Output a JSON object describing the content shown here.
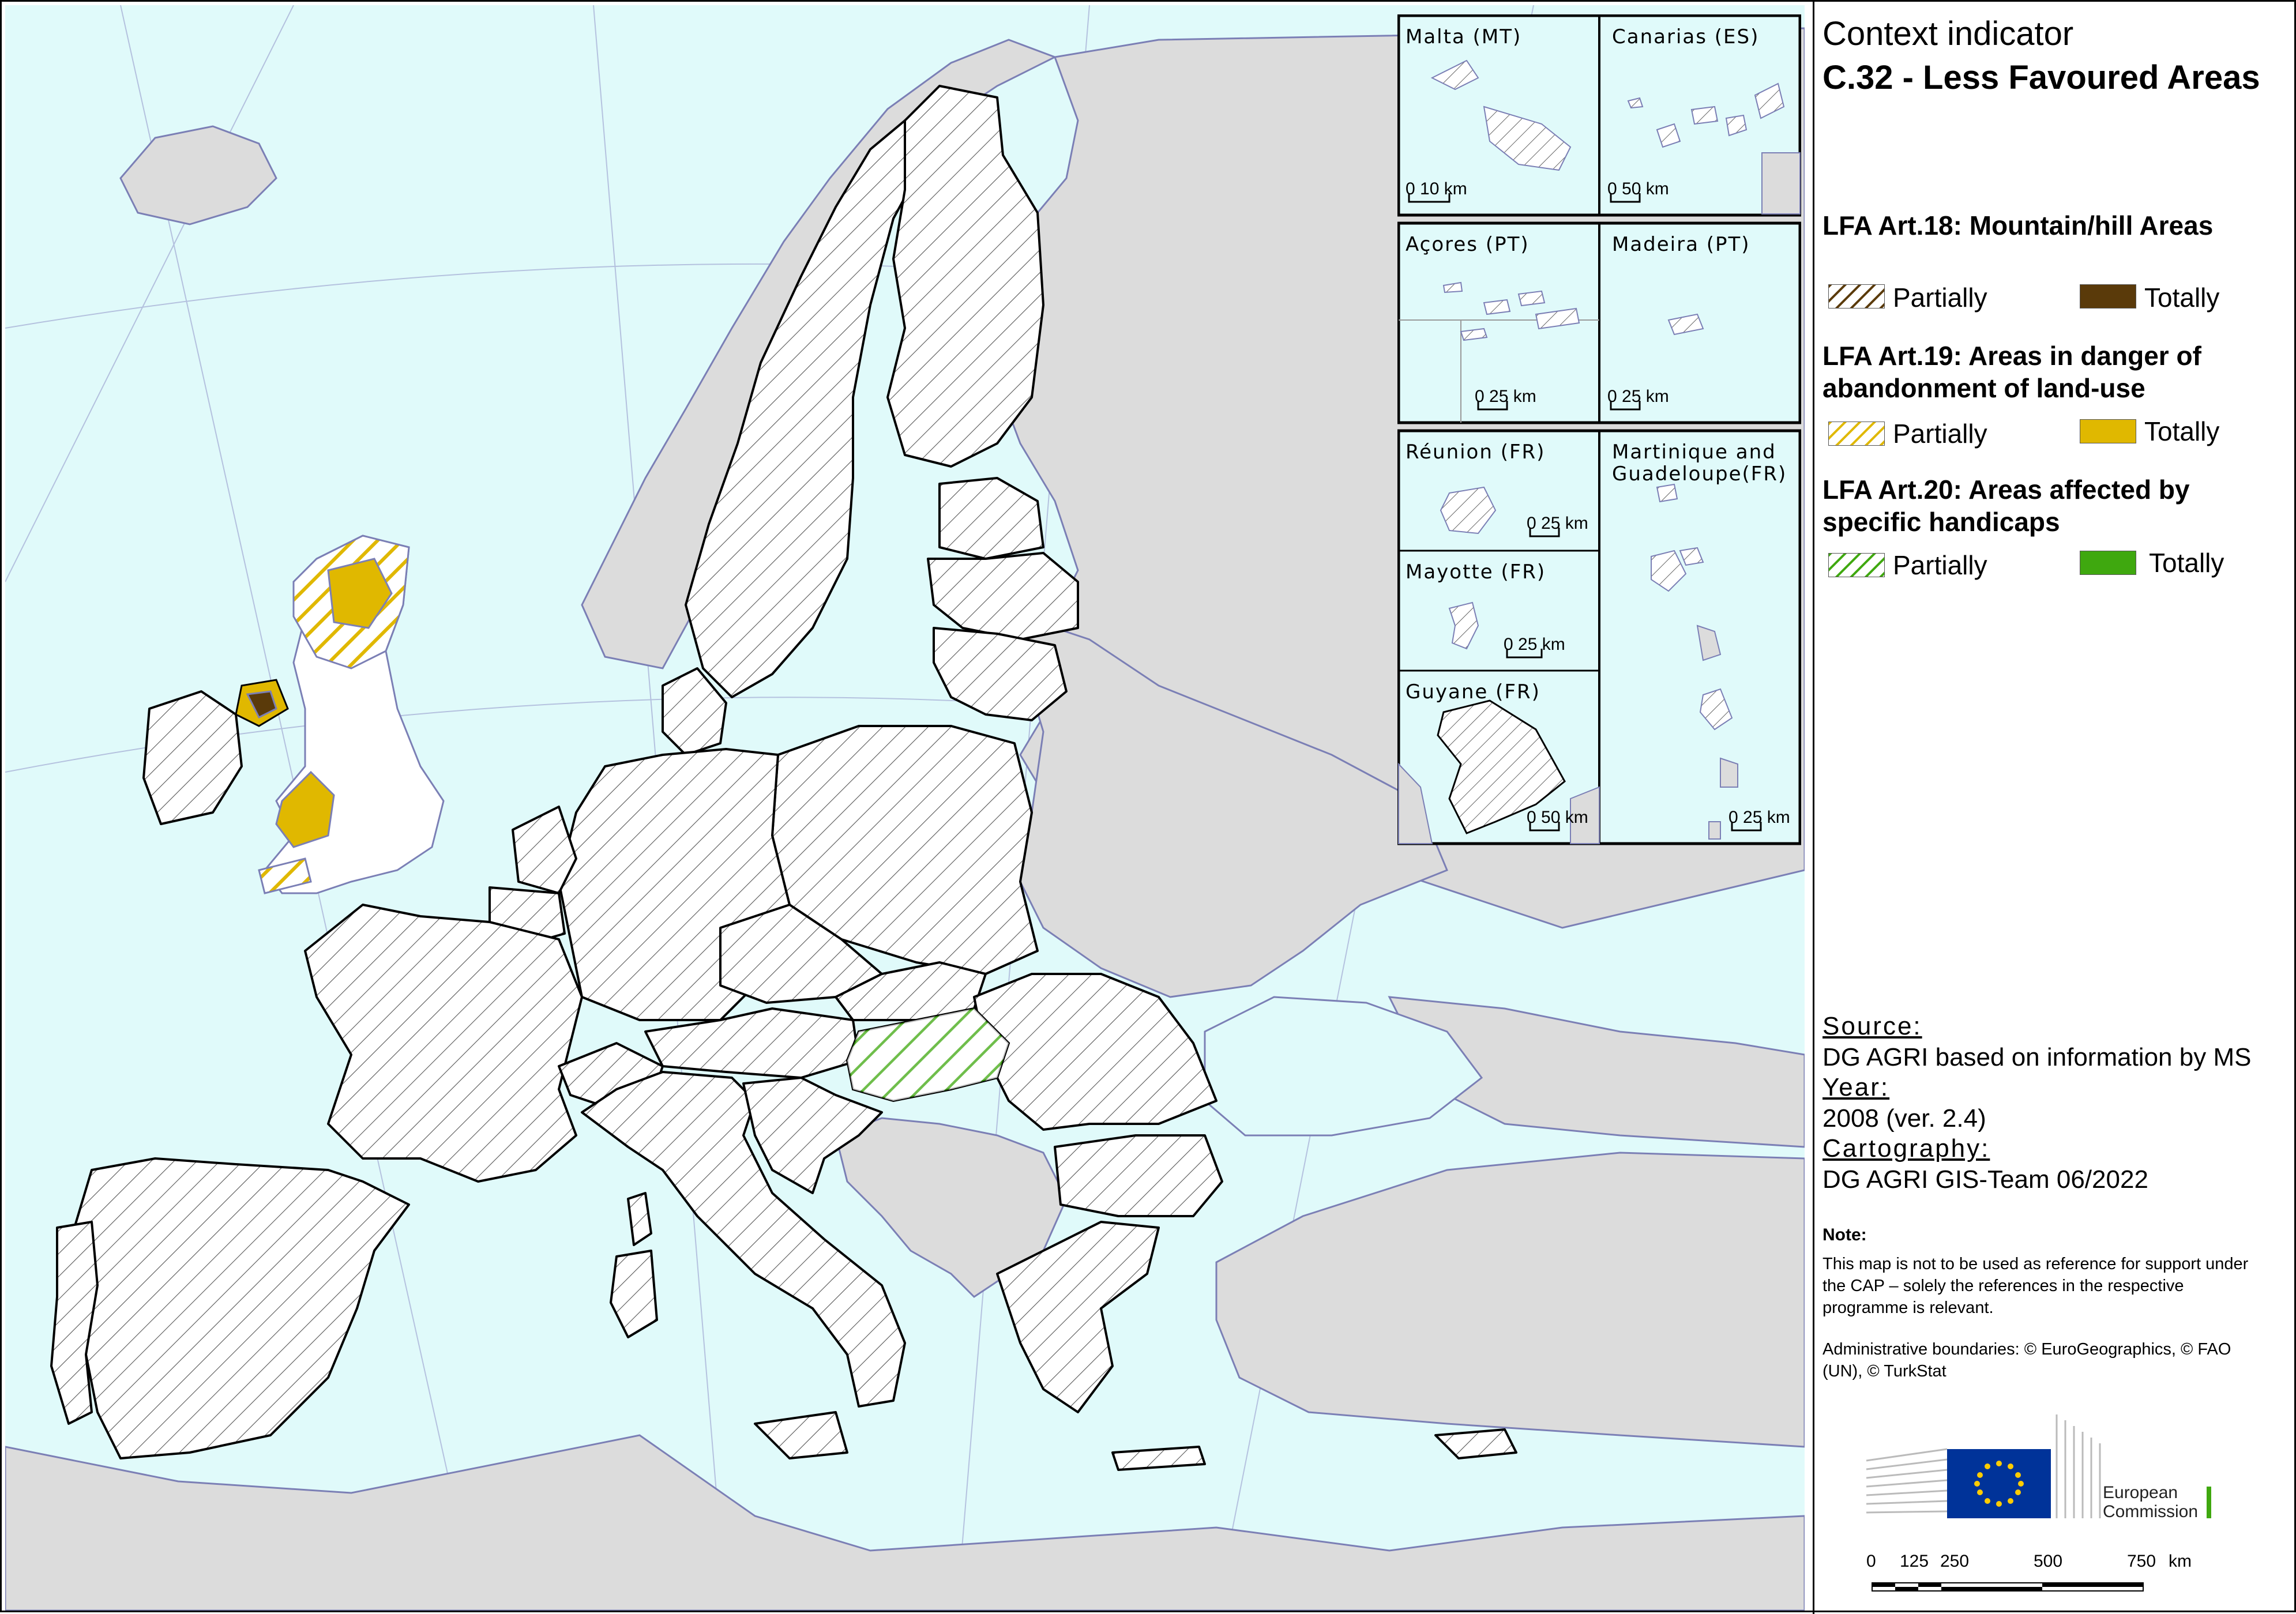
{
  "title": {
    "line1": "Context indicator",
    "line2": "C.32 - Less Favoured Areas"
  },
  "legend": {
    "art18": {
      "heading": "LFA Art.18: Mountain/hill Areas",
      "partially": "Partially",
      "totally": "Totally",
      "color": "#5a3a0a"
    },
    "art19": {
      "heading": "LFA Art.19: Areas in danger of abandonment of land-use",
      "partially": "Partially",
      "totally": "Totally",
      "color": "#e0b800"
    },
    "art20": {
      "heading": "LFA Art.20: Areas affected by specific handicaps",
      "partially": "Partially",
      "totally": "Totally",
      "color": "#3fa80f"
    }
  },
  "source": {
    "source_label": "Source:",
    "source_text": "DG AGRI based on information by MS",
    "year_label": "Year:",
    "year_text": "2008 (ver. 2.4)",
    "carto_label": "Cartography:",
    "carto_text": "DG AGRI GIS-Team 06/2022"
  },
  "note": {
    "label": "Note:",
    "text": "This map is not to be used as reference for support under the CAP – solely the references in the respective programme is relevant.",
    "admin": "Administrative boundaries: © EuroGeographics, © FAO (UN), © TurkStat"
  },
  "logo": {
    "line1": "European",
    "line2": "Commission"
  },
  "scalebar": {
    "labels": [
      "0",
      "125",
      "250",
      "500",
      "750"
    ],
    "unit": "km"
  },
  "insets": {
    "malta": {
      "name": "Malta (MT)",
      "scale": "0    10 km"
    },
    "canarias": {
      "name": "Canarias (ES)",
      "scale": "0 50 km"
    },
    "acores": {
      "name": "Açores (PT)",
      "scale": "0 25 km"
    },
    "madeira": {
      "name": "Madeira (PT)",
      "scale": "0 25 km"
    },
    "reunion": {
      "name": "Réunion (FR)",
      "scale": "0 25 km"
    },
    "martinique": {
      "name1": "Martinique and",
      "name2": "Guadeloupe(FR)",
      "scale": "0 25 km"
    },
    "mayotte": {
      "name": "Mayotte (FR)",
      "scale": "0    25 km"
    },
    "guyane": {
      "name": "Guyane (FR)",
      "scale": "0 50 km"
    }
  },
  "colors": {
    "sea": "#e0fafa",
    "non_eu_land": "#dcdcdc",
    "eu_land": "#ffffff",
    "hatch": "#555555",
    "coast": "#7b7fb5",
    "uk_art19": "#e0b800",
    "hu_art20": "#3fa80f"
  }
}
